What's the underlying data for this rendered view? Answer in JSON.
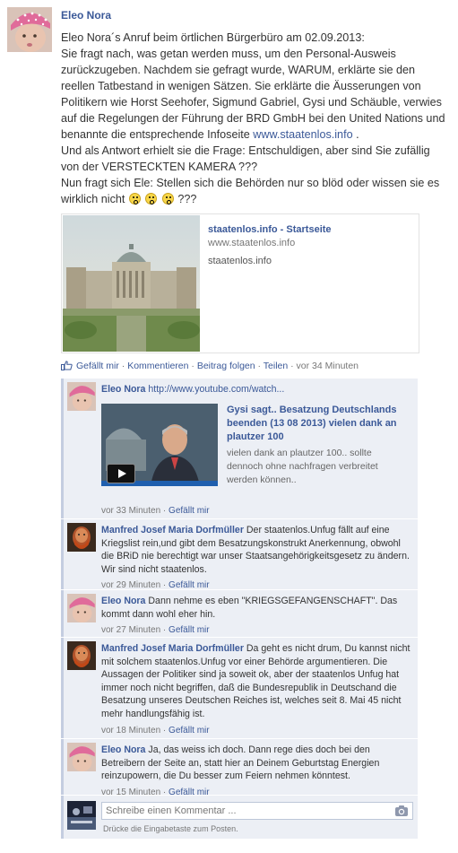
{
  "post": {
    "author": "Eleo Nora",
    "paragraph1": "Eleo Nora´s Anruf beim örtlichen Bürgerbüro am 02.09.2013:",
    "paragraph2_pre": "Sie fragt nach, was getan werden muss, um den Personal-Ausweis zurückzugeben. Nachdem sie gefragt wurde, WARUM, erklärte sie den reellen Tatbestand in wenigen Sätzen. Sie erklärte die Äusserungen von Politikern wie Horst Seehofer, Sigmund Gabriel, Gysi und Schäuble, verwies auf die Regelungen der Führung der BRD GmbH bei den United Nations und benannte die entsprechende Infoseite ",
    "paragraph2_link": "www.staatenlos.info",
    "paragraph2_post": " .",
    "paragraph3": "Und als Antwort erhielt sie die Frage: Entschuldigen, aber sind Sie zufällig von der VERSTECKTEN KAMERA ???",
    "paragraph4_pre": "Nun fragt sich Ele: Stellen sich die Behörden nur so blöd oder wissen sie es wirklich nicht",
    "paragraph4_post": "???",
    "link_preview": {
      "title": "staatenlos.info - Startseite",
      "url": "www.staatenlos.info",
      "description": "staatenlos.info"
    },
    "actions": {
      "like": "Gefällt mir",
      "comment": "Kommentieren",
      "follow": "Beitrag folgen",
      "share": "Teilen",
      "time": "vor 34 Minuten",
      "sep": "·"
    }
  },
  "comments": [
    {
      "author": "Eleo Nora",
      "text": "http://www.youtube.com/watch...",
      "video": {
        "title": "Gysi sagt.. Besatzung Deutschlands beenden (13 08 2013) vielen dank an plautzer 100",
        "description": "vielen dank an plautzer 100.. sollte dennoch ohne nachfragen verbreitet werden können.."
      },
      "time": "vor 33 Minuten",
      "like": "Gefällt mir"
    },
    {
      "author": "Manfred Josef Maria Dorfmüller",
      "text": "Der staatenlos.Unfug fällt auf eine Kriegslist rein,und gibt dem Besatzungskonstrukt Anerkennung, obwohl die BRiD nie berechtigt war unser Staatsangehörigkeitsgesetz zu ändern. Wir sind nicht staatenlos.",
      "time": "vor 29 Minuten",
      "like": "Gefällt mir"
    },
    {
      "author": "Eleo Nora",
      "text": "Dann nehme es eben \"KRIEGSGEFANGENSCHAFT\". Das kommt dann wohl eher hin.",
      "time": "vor 27 Minuten",
      "like": "Gefällt mir"
    },
    {
      "author": "Manfred Josef Maria Dorfmüller",
      "text": "Da geht es nicht drum, Du kannst nicht mit solchem staatenlos.Unfug vor einer Behörde argumentieren. Die Aussagen der Politiker sind ja soweit ok, aber der staatenlos Unfug hat immer noch nicht begriffen, daß die Bundesrepublik in Deutschand die Besatzung unseres Deutschen Reiches ist, welches seit 8. Mai 45 nicht mehr handlungsfähig ist.",
      "time": "vor 18 Minuten",
      "like": "Gefällt mir"
    },
    {
      "author": "Eleo Nora",
      "text": "Ja, das weiss ich doch. Dann rege dies doch bei den Betreibern der Seite an, statt hier an Deinem Geburtstag Energien reinzupowern, die Du besser zum Feiern nehmen könntest.",
      "time": "vor 15 Minuten",
      "like": "Gefällt mir"
    }
  ],
  "composer": {
    "placeholder": "Schreibe einen Kommentar ...",
    "hint": "Drücke die Eingabetaste zum Posten."
  },
  "colors": {
    "link": "#3b5998",
    "comment_bg": "#eceff5",
    "comment_border": "#c4cde0"
  },
  "icons": [
    "like-icon",
    "camera-icon",
    "play-icon",
    "emoji-icon"
  ]
}
